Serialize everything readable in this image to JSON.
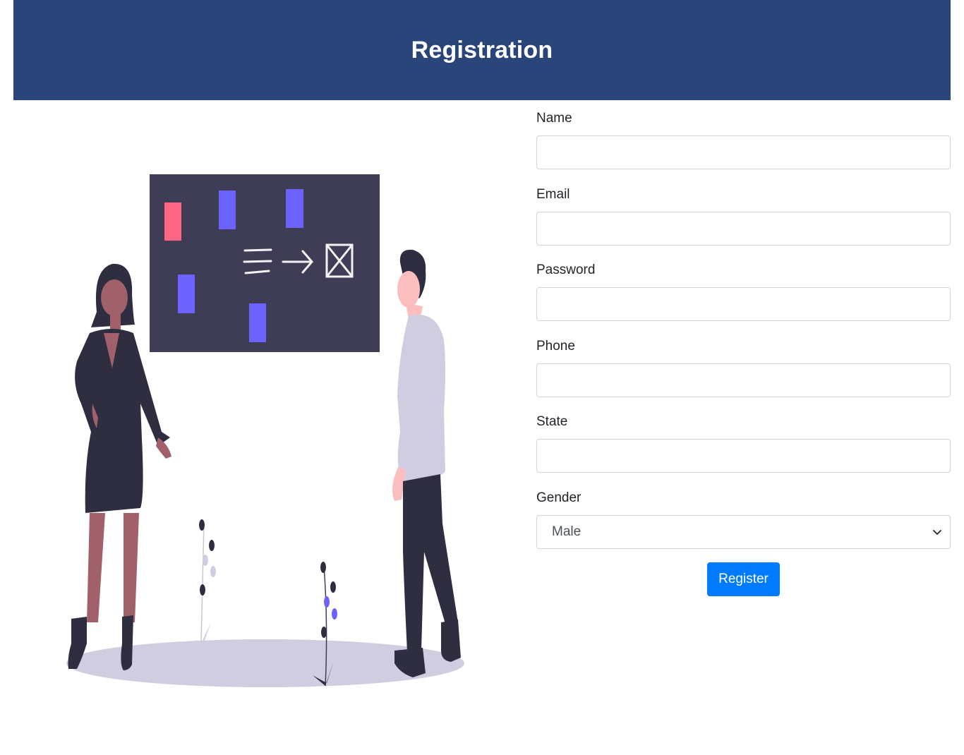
{
  "header": {
    "title": "Registration"
  },
  "form": {
    "fields": [
      {
        "label": "Name",
        "value": ""
      },
      {
        "label": "Email",
        "value": ""
      },
      {
        "label": "Password",
        "value": ""
      },
      {
        "label": "Phone",
        "value": ""
      },
      {
        "label": "State",
        "value": ""
      }
    ],
    "gender": {
      "label": "Gender",
      "selected": "Male"
    },
    "submit_label": "Register"
  },
  "colors": {
    "header_bg": "#2a457a",
    "button_bg": "#007bff",
    "board_bg": "#3f3d56",
    "accent_purple": "#6c63ff",
    "accent_pink": "#ff6584"
  },
  "illustration": {
    "icon": "team-whiteboard-illustration"
  }
}
